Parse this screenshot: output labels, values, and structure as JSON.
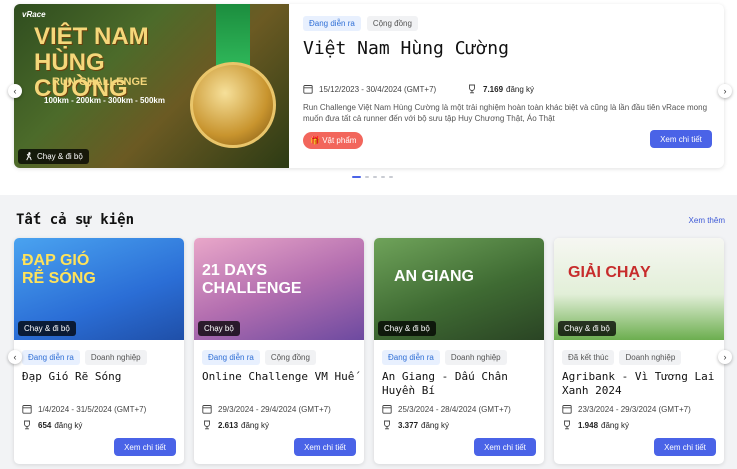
{
  "hero": {
    "image_brand": "vRace",
    "image_title": "VIỆT NAM HÙNG CƯỜNG",
    "image_subtitle": "RUN CHALLENGE",
    "image_distances": "100km - 200km - 300km - 500km",
    "image_tag": "Chạy & đi bộ",
    "status_badge": "Đang diễn ra",
    "category_badge": "Cộng đồng",
    "title": "Việt Nam Hùng Cường",
    "date": "15/12/2023 - 30/4/2024 (GMT+7)",
    "registered_count": "7.169",
    "registered_label": "đăng ký",
    "description": "Run Challenge Việt Nam Hùng Cường là một trải nghiệm hoàn toàn khác biệt và cũng là lần đầu tiên vRace mong muốn đưa tất cả runner đến với bộ sưu tập Huy Chương Thật, Áo Thật",
    "prize_label": "Vật phẩm",
    "button_label": "Xem chi tiết"
  },
  "section": {
    "title": "Tất cả sự kiện",
    "see_more": "Xem thêm"
  },
  "events": [
    {
      "image_title": "ĐẠP GIÓ RẼ SÓNG",
      "image_tag": "Chạy & đi bộ",
      "status": "Đang diễn ra",
      "category": "Doanh nghiệp",
      "title": "Đạp Gió Rẽ Sóng",
      "date": "1/4/2024 - 31/5/2024 (GMT+7)",
      "count": "654",
      "count_label": "đăng ký",
      "button": "Xem chi tiết"
    },
    {
      "image_title": "21 DAYS CHALLENGE",
      "image_tag": "Chạy bộ",
      "status": "Đang diễn ra",
      "category": "Cộng đồng",
      "title": "Online Challenge VM Huế",
      "date": "29/3/2024 - 29/4/2024 (GMT+7)",
      "count": "2.613",
      "count_label": "đăng ký",
      "button": "Xem chi tiết"
    },
    {
      "image_title": "AN GIANG",
      "image_tag": "Chạy & đi bộ",
      "status": "Đang diễn ra",
      "category": "Doanh nghiệp",
      "title": "An Giang - Dấu Chân Huyền Bí",
      "date": "25/3/2024 - 28/4/2024 (GMT+7)",
      "count": "3.377",
      "count_label": "đăng ký",
      "button": "Xem chi tiết"
    },
    {
      "image_title": "GIẢI CHẠY",
      "image_tag": "Chạy & đi bộ",
      "status": "Đã kết thúc",
      "category": "Doanh nghiệp",
      "title": "Agribank - Vì Tương Lai Xanh 2024",
      "date": "23/3/2024 - 29/3/2024 (GMT+7)",
      "count": "1.948",
      "count_label": "đăng ký",
      "button": "Xem chi tiết"
    }
  ],
  "colors": {
    "accent": "#4a63e7",
    "prize": "#f2665c"
  }
}
